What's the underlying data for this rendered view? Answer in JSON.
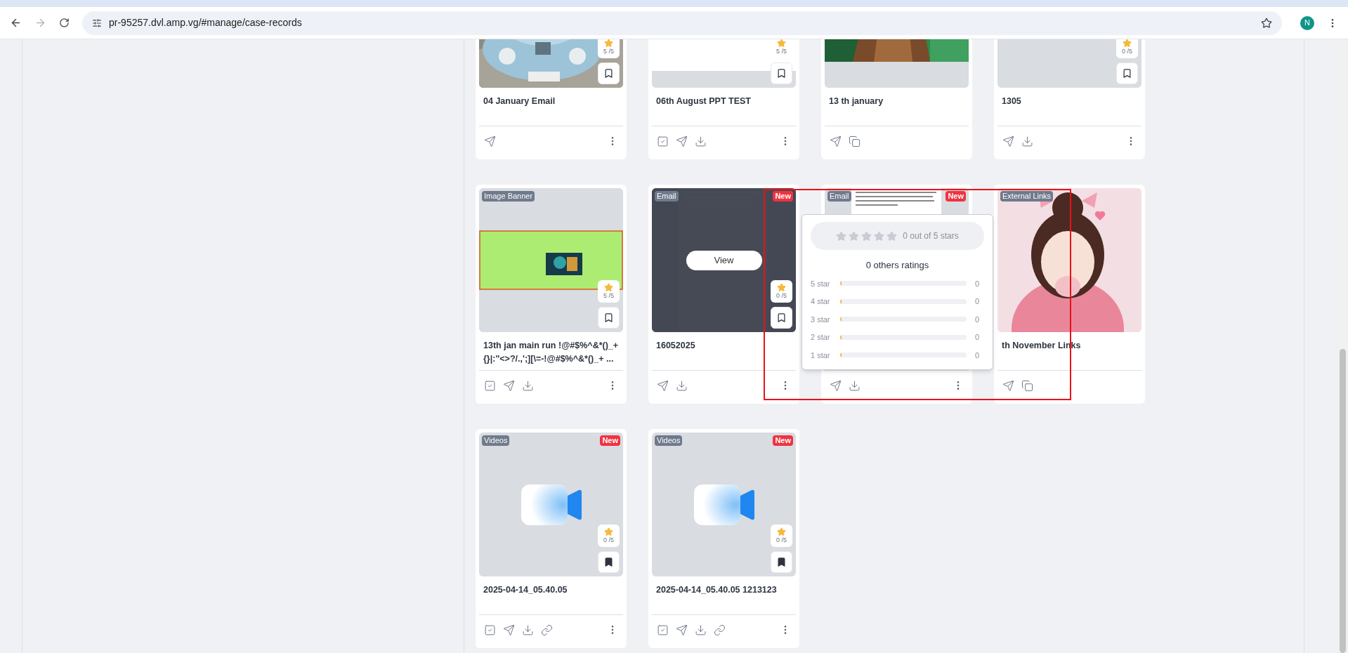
{
  "browser": {
    "url": "pr-95257.dvl.amp.vg/#manage/case-records",
    "profile_initial": "N"
  },
  "cards": [
    {
      "preview": {
        "kind": "car"
      },
      "rating": "5 /5",
      "bookmark": {
        "filled": false
      },
      "title": "04 January Email",
      "actions": [
        {
          "kind": "send"
        },
        {
          "kind": "more"
        }
      ]
    },
    {
      "preview": {
        "kind": "document"
      },
      "rating": "5 /5",
      "bookmark": {
        "filled": false
      },
      "title": "06th August PPT TEST",
      "actions": [
        {
          "kind": "check"
        },
        {
          "kind": "send"
        },
        {
          "kind": "download"
        },
        {
          "kind": "more"
        }
      ]
    },
    {
      "preview": {
        "kind": "boardwalk"
      },
      "title": "13 th january",
      "actions": [
        {
          "kind": "send"
        },
        {
          "kind": "copy"
        }
      ]
    },
    {
      "preview": {
        "kind": "blank"
      },
      "rating": "0 /5",
      "bookmark": {
        "filled": false
      },
      "title": "1305",
      "actions": [
        {
          "kind": "send"
        },
        {
          "kind": "download"
        },
        {
          "kind": "more"
        }
      ]
    },
    {
      "type_label": "Image Banner",
      "preview": {
        "kind": "banner"
      },
      "rating": "5 /5",
      "bookmark": {
        "filled": false
      },
      "title": "13th jan main run !@#$%^&*()_+ {}|:\"<>?/.,';][\\=-!@#$%^&*()_+ ...",
      "actions": [
        {
          "kind": "check"
        },
        {
          "kind": "send"
        },
        {
          "kind": "download"
        },
        {
          "kind": "more"
        }
      ]
    },
    {
      "type_label": "Email",
      "new_label": "New",
      "preview": {
        "kind": "email"
      },
      "hover_button": "View",
      "rating": "0 /5",
      "bookmark": {
        "filled": false
      },
      "title": "16052025",
      "actions": [
        {
          "kind": "send"
        },
        {
          "kind": "download"
        },
        {
          "kind": "more"
        }
      ]
    },
    {
      "type_label": "Email",
      "new_label": "New",
      "preview": {
        "kind": "email-light"
      },
      "actions": [
        {
          "kind": "send"
        },
        {
          "kind": "download"
        },
        {
          "kind": "more"
        }
      ]
    },
    {
      "type_label": "External Links",
      "preview": {
        "kind": "illustration"
      },
      "title": "th November Links",
      "actions": [
        {
          "kind": "send"
        },
        {
          "kind": "copy"
        }
      ]
    },
    {
      "type_label": "Videos",
      "new_label": "New",
      "preview": {
        "kind": "video"
      },
      "rating": "0 /5",
      "bookmark": {
        "filled": true
      },
      "title": "2025-04-14_05.40.05",
      "actions": [
        {
          "kind": "check"
        },
        {
          "kind": "send"
        },
        {
          "kind": "download"
        },
        {
          "kind": "link"
        },
        {
          "kind": "more"
        }
      ]
    },
    {
      "type_label": "Videos",
      "new_label": "New",
      "preview": {
        "kind": "video"
      },
      "rating": "0 /5",
      "bookmark": {
        "filled": true
      },
      "title": "2025-04-14_05.40.05 1213123",
      "actions": [
        {
          "kind": "check"
        },
        {
          "kind": "send"
        },
        {
          "kind": "download"
        },
        {
          "kind": "link"
        },
        {
          "kind": "more"
        }
      ]
    }
  ],
  "rating_popover": {
    "stars": 0,
    "summary": "0 out of 5 stars",
    "heading": "0 others ratings",
    "rows": [
      {
        "label": "5 star",
        "level": 0,
        "count": "0"
      },
      {
        "label": "4 star",
        "level": 0,
        "count": "0"
      },
      {
        "label": "3 star",
        "level": 0,
        "count": "0"
      },
      {
        "label": "2 star",
        "level": 0,
        "count": "0"
      },
      {
        "label": "1 star",
        "level": 0,
        "count": "0"
      }
    ]
  }
}
